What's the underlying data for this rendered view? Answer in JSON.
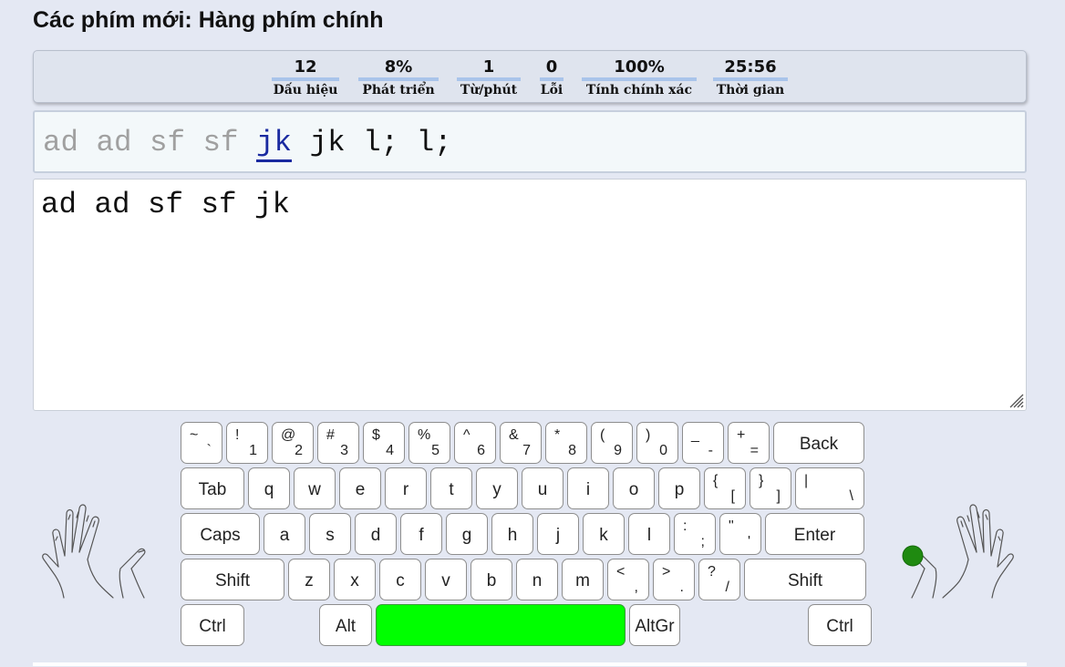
{
  "title": "Các phím mới: Hàng phím chính",
  "stats": [
    {
      "value": "12",
      "label": "Dấu hiệu"
    },
    {
      "value": "8%",
      "label": "Phát triển"
    },
    {
      "value": "1",
      "label": "Từ/phút"
    },
    {
      "value": "0",
      "label": "Lỗi"
    },
    {
      "value": "100%",
      "label": "Tính chính xác"
    },
    {
      "value": "25:56",
      "label": "Thời gian"
    }
  ],
  "lesson": {
    "done": "ad ad sf sf ",
    "current": "jk",
    "remaining": " jk l; l;"
  },
  "typed": "ad ad sf sf jk",
  "keyboard": {
    "row1": [
      {
        "top": "~",
        "bottom": "`"
      },
      {
        "top": "!",
        "bottom": "1"
      },
      {
        "top": "@",
        "bottom": "2"
      },
      {
        "top": "#",
        "bottom": "3"
      },
      {
        "top": "$",
        "bottom": "4"
      },
      {
        "top": "%",
        "bottom": "5"
      },
      {
        "top": "^",
        "bottom": "6"
      },
      {
        "top": "&",
        "bottom": "7"
      },
      {
        "top": "*",
        "bottom": "8"
      },
      {
        "top": "(",
        "bottom": "9"
      },
      {
        "top": ")",
        "bottom": "0"
      },
      {
        "top": "_",
        "bottom": "-"
      },
      {
        "top": "+",
        "bottom": "="
      },
      {
        "label": "Back"
      }
    ],
    "row2": [
      {
        "label": "Tab"
      },
      {
        "label": "q"
      },
      {
        "label": "w"
      },
      {
        "label": "e"
      },
      {
        "label": "r"
      },
      {
        "label": "t"
      },
      {
        "label": "y"
      },
      {
        "label": "u"
      },
      {
        "label": "i"
      },
      {
        "label": "o"
      },
      {
        "label": "p"
      },
      {
        "top": "{",
        "bottom": "["
      },
      {
        "top": "}",
        "bottom": "]"
      },
      {
        "top": "|",
        "bottom": "\\"
      }
    ],
    "row3": [
      {
        "label": "Caps"
      },
      {
        "label": "a"
      },
      {
        "label": "s"
      },
      {
        "label": "d"
      },
      {
        "label": "f"
      },
      {
        "label": "g"
      },
      {
        "label": "h"
      },
      {
        "label": "j"
      },
      {
        "label": "k"
      },
      {
        "label": "l"
      },
      {
        "top": ":",
        "bottom": ";"
      },
      {
        "top": "\"",
        "bottom": "'"
      },
      {
        "label": "Enter"
      }
    ],
    "row4": [
      {
        "label": "Shift"
      },
      {
        "label": "z"
      },
      {
        "label": "x"
      },
      {
        "label": "c"
      },
      {
        "label": "v"
      },
      {
        "label": "b"
      },
      {
        "label": "n"
      },
      {
        "label": "m"
      },
      {
        "top": "<",
        "bottom": ","
      },
      {
        "top": ">",
        "bottom": "."
      },
      {
        "top": "?",
        "bottom": "/"
      },
      {
        "label": "Shift"
      }
    ],
    "row5": [
      {
        "label": "Ctrl"
      },
      {
        "label": "Alt"
      },
      {
        "label": ""
      },
      {
        "label": "AltGr"
      },
      {
        "label": "Ctrl"
      }
    ]
  },
  "colors": {
    "highlight_key": "#00ff00",
    "finger_marker": "#1f8a10",
    "current_word": "#1a2aa0"
  },
  "icons": [
    "left-hand-icon",
    "right-hand-icon",
    "resize-grip-icon"
  ]
}
